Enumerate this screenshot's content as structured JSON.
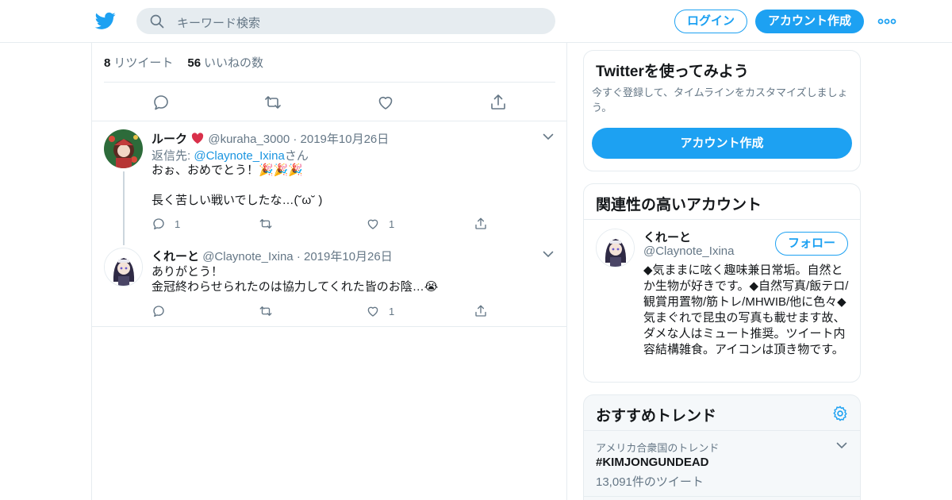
{
  "header": {
    "search_placeholder": "キーワード検索",
    "login_label": "ログイン",
    "signup_label": "アカウント作成"
  },
  "main_tweet": {
    "retweet_count": "8",
    "retweet_label": "リツイート",
    "like_count": "56",
    "like_label": "いいねの数"
  },
  "replies": [
    {
      "name": "ルーク",
      "handle": "@kuraha_3000",
      "dot": "·",
      "date": "2019年10月26日",
      "reply_prefix": "返信先: ",
      "reply_handle": "@Claynote_Ixina",
      "reply_suffix": "さん",
      "text": "おぉ、おめでとう！🎉🎉🎉\n\n長く苦しい戦いでしたな…(˘ω˘ )",
      "reply_count": "1",
      "retweet_count": "",
      "like_count": "1"
    },
    {
      "name": "くれーと",
      "handle": "@Claynote_Ixina",
      "dot": "·",
      "date": "2019年10月26日",
      "text": "ありがとう！\n金冠終わらせられたのは協力してくれた皆のお陰…😭",
      "reply_count": "",
      "retweet_count": "",
      "like_count": "1"
    }
  ],
  "signup_card": {
    "title": "Twitterを使ってみよう",
    "description": "今すぐ登録して、タイムラインをカスタマイズしましょう。",
    "button_label": "アカウント作成"
  },
  "related_card": {
    "title": "関連性の高いアカウント",
    "name": "くれーと",
    "handle": "@Claynote_Ixina",
    "follow_label": "フォロー",
    "bio": "◆気ままに呟く趣味兼日常垢。自然とか生物が好きです。◆自然写真/飯テロ/観賞用置物/筋トレ/MHWIB/他に色々◆気まぐれで昆虫の写真も載せます故、ダメな人はミュート推奨。ツイート内容結構雑食。アイコンは頂き物です。"
  },
  "trends_card": {
    "title": "おすすめトレンド",
    "location": "アメリカ合衆国のトレンド",
    "tag": "#KIMJONGUNDEAD",
    "count": "13,091件のツイート"
  },
  "colors": {
    "accent": "#1da1f2",
    "link": "#1b95e0",
    "secondary_text": "#657786",
    "border": "#e6ecf0",
    "like_icon": "#657786"
  },
  "icons": [
    "twitter-bird-icon",
    "search-icon",
    "more-icon",
    "reply-icon",
    "retweet-icon",
    "like-icon",
    "share-icon",
    "chevron-down-icon",
    "gear-icon",
    "emoji-heart-icon"
  ]
}
